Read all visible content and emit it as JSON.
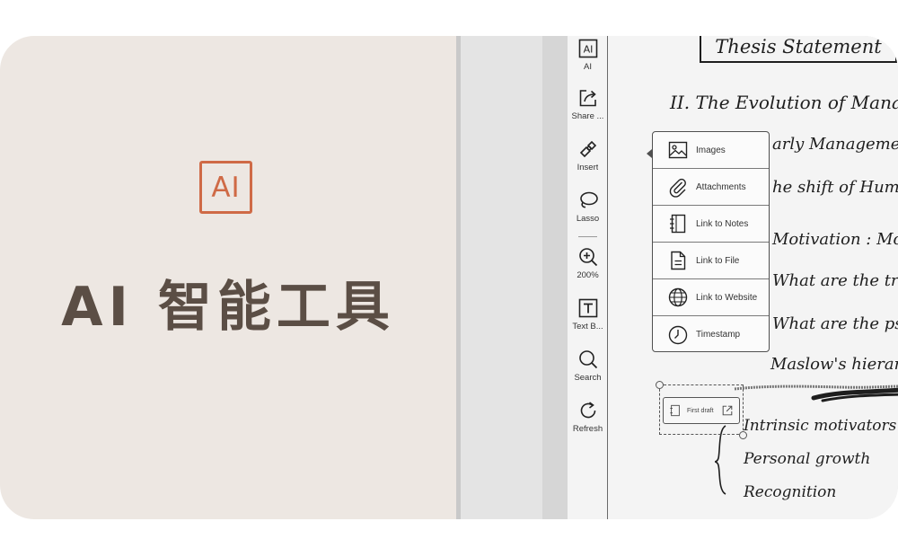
{
  "banner": {
    "badge_text": "AI",
    "title": "AI 智能工具",
    "colors": {
      "background": "#ede7e2",
      "badge": "#cf6a46",
      "title": "#5b4e45"
    }
  },
  "toolbar": {
    "items": [
      {
        "label": "AI",
        "icon": "ai-icon"
      },
      {
        "label": "Share ...",
        "icon": "share-icon"
      },
      {
        "label": "Insert",
        "icon": "insert-puzzle-icon"
      },
      {
        "label": "Lasso",
        "icon": "lasso-icon"
      },
      {
        "label": "200%",
        "icon": "zoom-in-icon"
      },
      {
        "label": "Text B...",
        "icon": "text-box-icon"
      },
      {
        "label": "Search",
        "icon": "search-icon"
      },
      {
        "label": "Refresh",
        "icon": "refresh-icon"
      }
    ]
  },
  "insert_menu": {
    "items": [
      {
        "label": "Images",
        "icon": "image-icon"
      },
      {
        "label": "Attachments",
        "icon": "paperclip-icon"
      },
      {
        "label": "Link to Notes",
        "icon": "notebook-icon"
      },
      {
        "label": "Link to File",
        "icon": "file-icon"
      },
      {
        "label": "Link to Website",
        "icon": "globe-icon"
      },
      {
        "label": "Timestamp",
        "icon": "clock-icon"
      }
    ]
  },
  "notes": {
    "thesis": "Thesis Statement",
    "lines": [
      "II.  The Evolution of Management",
      "arly Management Mo",
      "he shift  of  Huma",
      "Motivation : Monetary",
      "What are the traditio",
      "What are  the psycholo",
      "Maslow's  hierarchy",
      "Intrinsic motivators",
      "Personal growth",
      "Recognition"
    ]
  },
  "first_draft": {
    "label": "First draft"
  }
}
